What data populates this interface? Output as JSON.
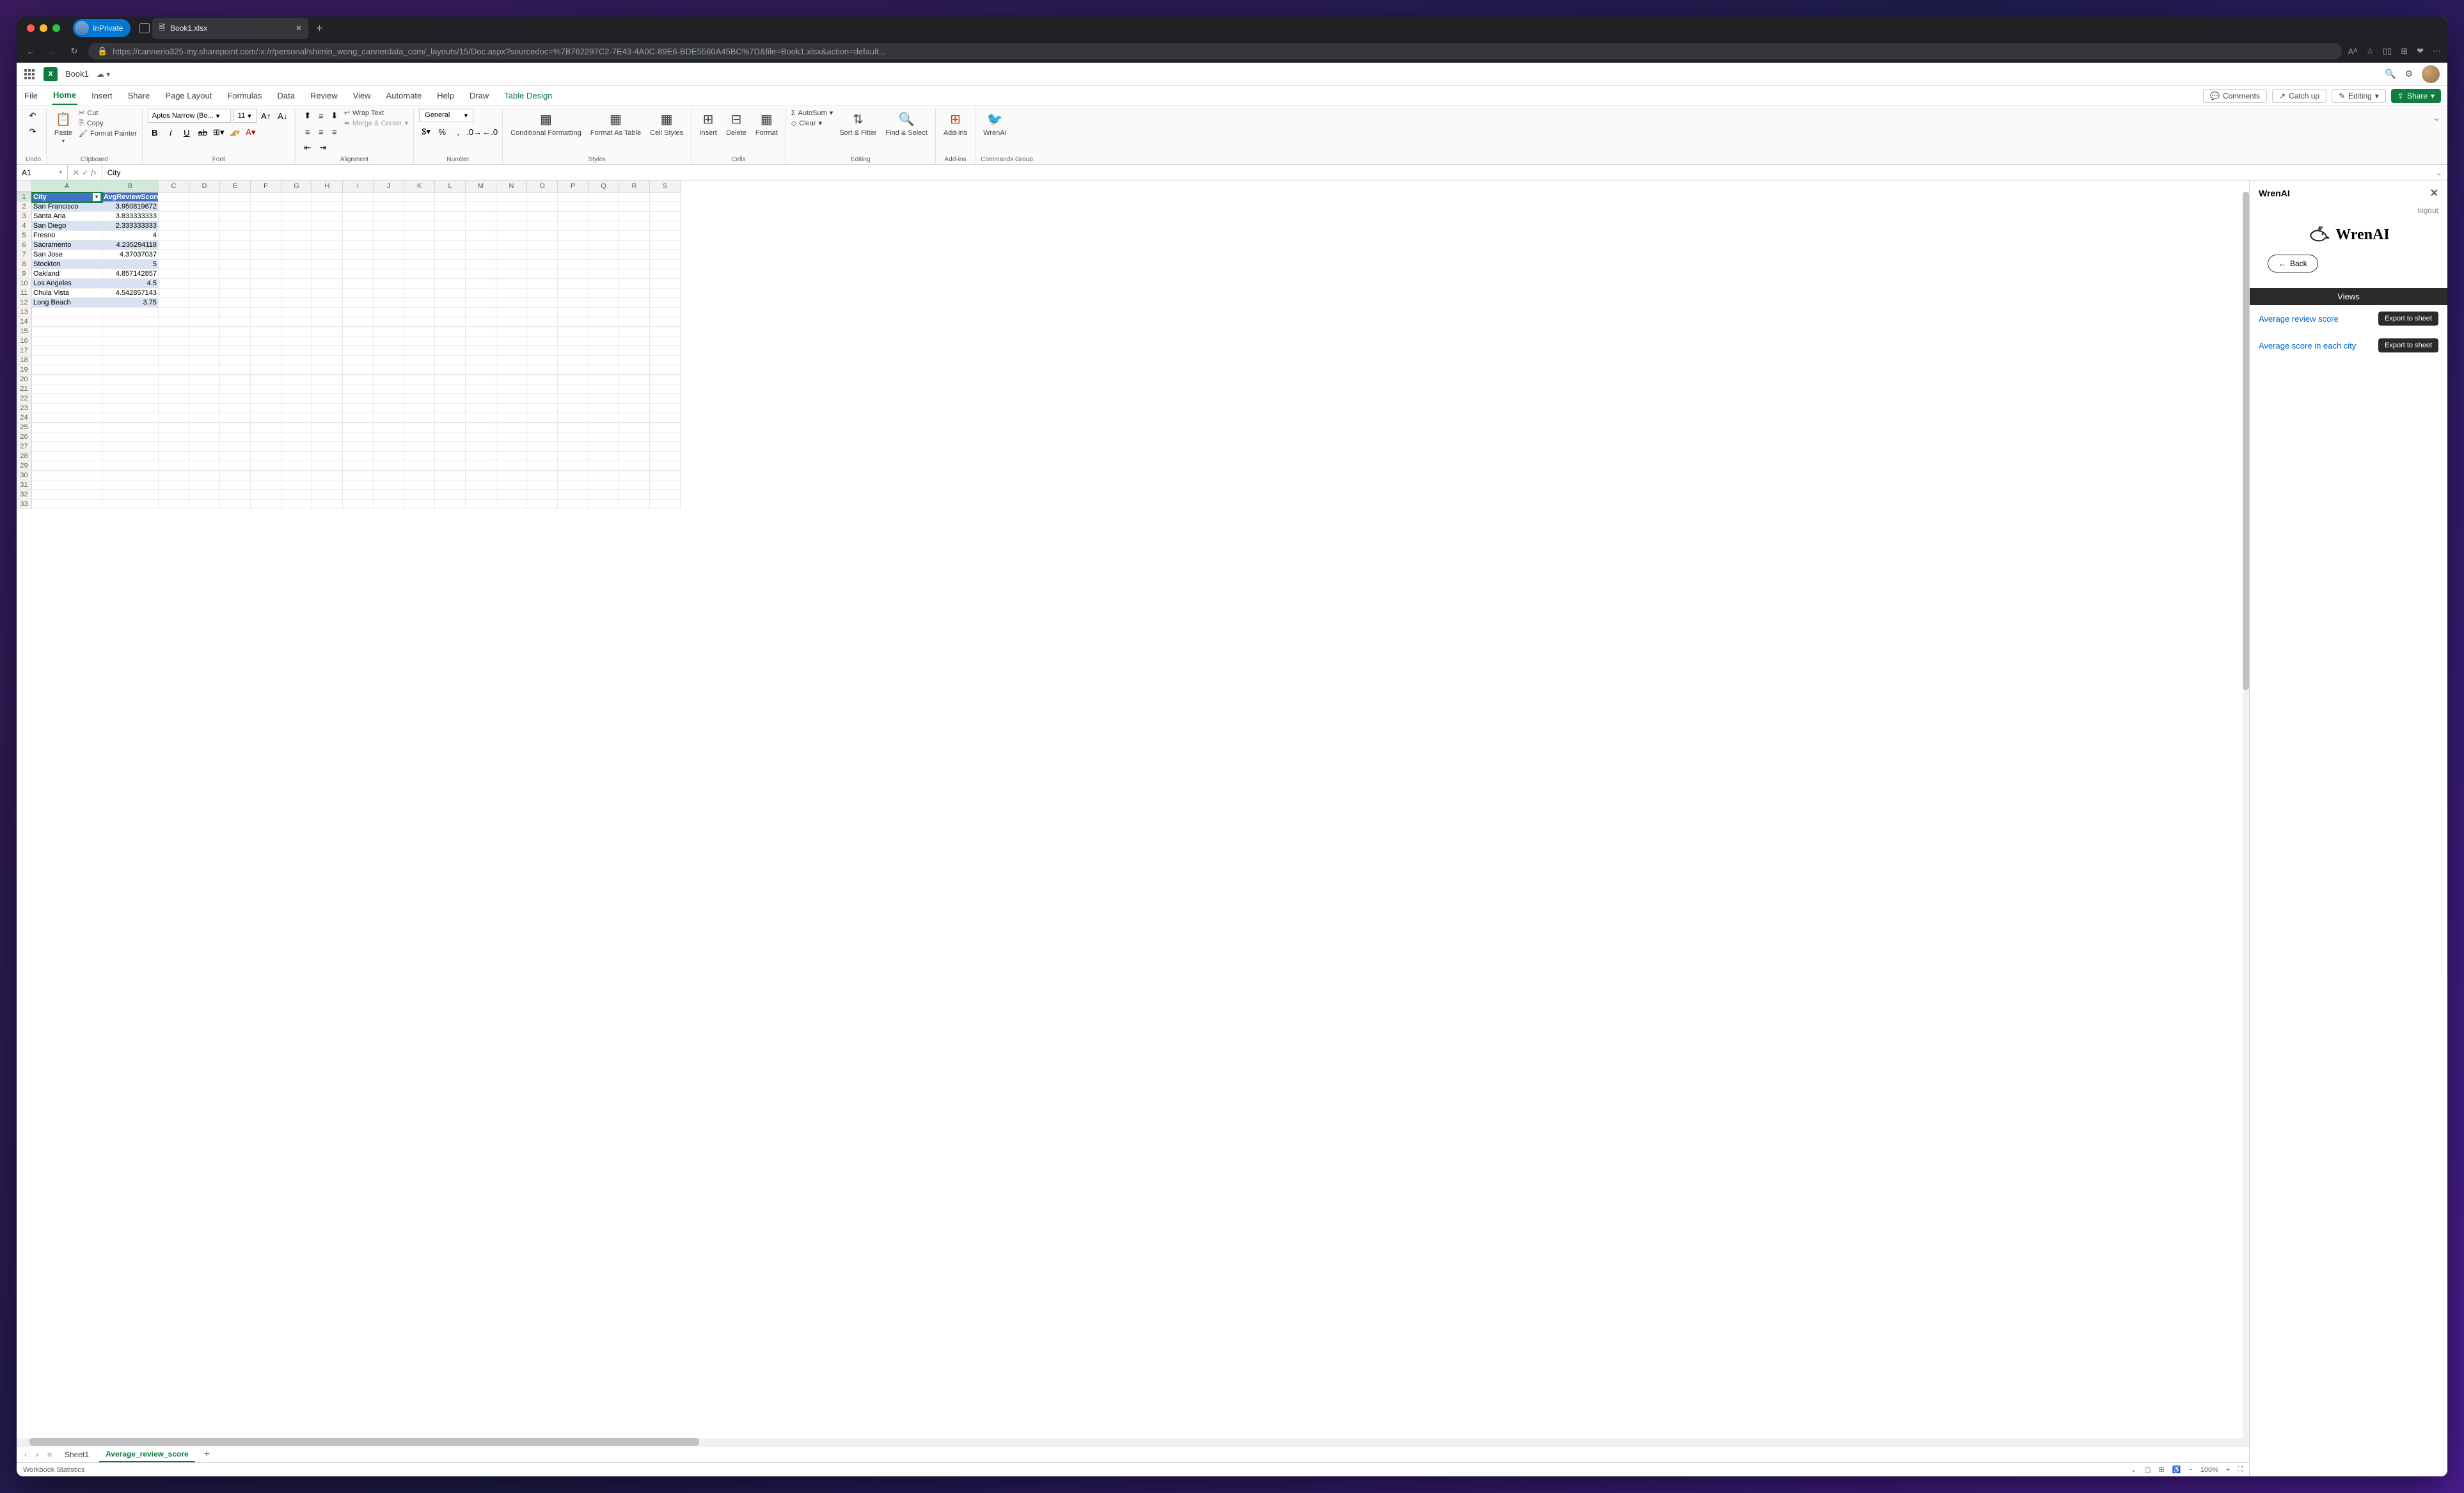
{
  "browser": {
    "inprivate_label": "InPrivate",
    "tab_title": "Book1.xlsx",
    "url": "https://cannerio325-my.sharepoint.com/:x:/r/personal/shimin_wong_cannerdata_com/_layouts/15/Doc.aspx?sourcedoc=%7B762297C2-7E43-4A0C-89E6-BDE5560A45BC%7D&file=Book1.xlsx&action=default..."
  },
  "excel": {
    "doc_name": "Book1",
    "tabs": {
      "file": "File",
      "home": "Home",
      "insert": "Insert",
      "share": "Share",
      "layout": "Page Layout",
      "formulas": "Formulas",
      "data": "Data",
      "review": "Review",
      "view": "View",
      "automate": "Automate",
      "help": "Help",
      "draw": "Draw",
      "table_design": "Table Design"
    },
    "right_pills": {
      "comments": "Comments",
      "catchup": "Catch up",
      "editing": "Editing",
      "share": "Share"
    },
    "ribbon": {
      "undo_label": "Undo",
      "paste": "Paste",
      "cut": "Cut",
      "copy": "Copy",
      "painter": "Format Painter",
      "clipboard_label": "Clipboard",
      "font_name": "Aptos Narrow (Bo...",
      "font_size": "11",
      "wrap": "Wrap Text",
      "merge": "Merge & Center",
      "font_label": "Font",
      "alignment_label": "Alignment",
      "num_format": "General",
      "number_label": "Number",
      "cond_fmt": "Conditional Formatting",
      "fmt_table": "Format As Table",
      "cell_styles": "Cell Styles",
      "styles_label": "Styles",
      "insert_btn": "Insert",
      "delete_btn": "Delete",
      "format_btn": "Format",
      "cells_label": "Cells",
      "autosum": "AutoSum",
      "clear": "Clear",
      "sort_filter": "Sort & Filter",
      "find_select": "Find & Select",
      "editing_label": "Editing",
      "addins": "Add-ins",
      "addins_label": "Add-ins",
      "wrenai": "WrenAI",
      "commands_label": "Commands Group"
    },
    "formula": {
      "name_box": "A1",
      "value": "City"
    },
    "columns": [
      "A",
      "B",
      "C",
      "D",
      "E",
      "F",
      "G",
      "H",
      "I",
      "J",
      "K",
      "L",
      "M",
      "N",
      "O",
      "P",
      "Q",
      "R",
      "S"
    ],
    "col_widths": {
      "A": 110,
      "B": 88,
      "other": 48
    },
    "header_cells": {
      "A": "City",
      "B": "AvgReviewScore"
    },
    "rows": [
      {
        "n": 2,
        "city": "San Francisco",
        "score": "3.950819672"
      },
      {
        "n": 3,
        "city": "Santa Ana",
        "score": "3.833333333"
      },
      {
        "n": 4,
        "city": "San Diego",
        "score": "2.333333333"
      },
      {
        "n": 5,
        "city": "Fresno",
        "score": "4"
      },
      {
        "n": 6,
        "city": "Sacramento",
        "score": "4.235294118"
      },
      {
        "n": 7,
        "city": "San Jose",
        "score": "4.37037037"
      },
      {
        "n": 8,
        "city": "Stockton",
        "score": "5"
      },
      {
        "n": 9,
        "city": "Oakland",
        "score": "4.857142857"
      },
      {
        "n": 10,
        "city": "Los Angeles",
        "score": "4.5"
      },
      {
        "n": 11,
        "city": "Chula Vista",
        "score": "4.542857143"
      },
      {
        "n": 12,
        "city": "Long Beach",
        "score": "3.75"
      }
    ],
    "empty_rows_start": 13,
    "empty_rows_end": 33,
    "sheet_tabs": {
      "sheet1": "Sheet1",
      "avg": "Average_review_score"
    },
    "status": {
      "wb_stats": "Workbook Statistics",
      "zoom": "100%"
    }
  },
  "wren": {
    "title": "WrenAI",
    "logout": "logout",
    "brand": "WrenAI",
    "back": "Back",
    "views_header": "Views",
    "export_label": "Export to sheet",
    "views": {
      "v1": "Average review score",
      "v2": "Average score in each city"
    }
  }
}
